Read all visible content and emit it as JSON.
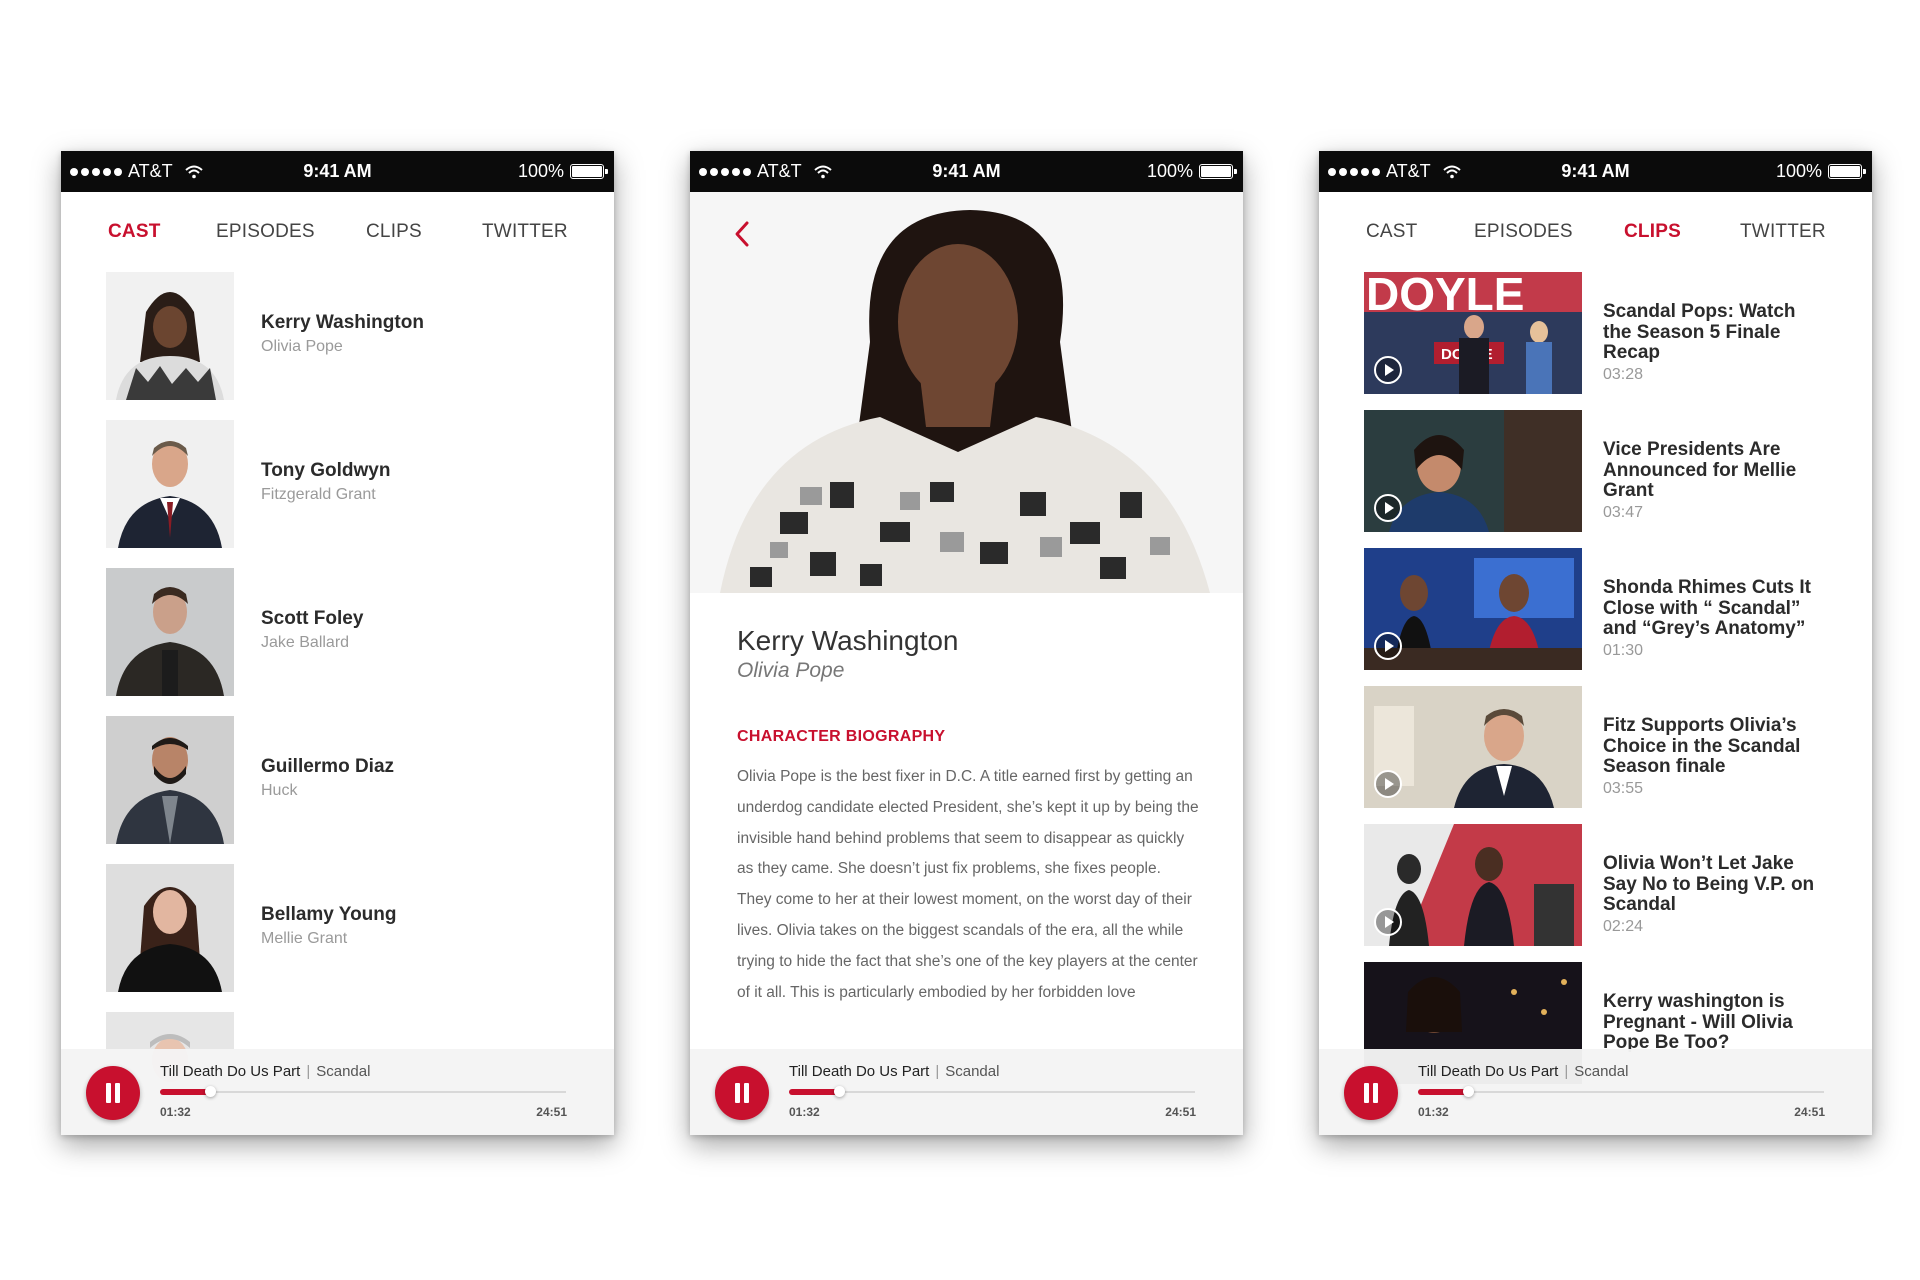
{
  "status": {
    "carrier": "AT&T",
    "time": "9:41 AM",
    "battery": "100%"
  },
  "tabs": [
    "CAST",
    "EPISODES",
    "CLIPS",
    "TWITTER"
  ],
  "cast": [
    {
      "name": "Kerry Washington",
      "role": "Olivia Pope"
    },
    {
      "name": "Tony Goldwyn",
      "role": "Fitzgerald Grant"
    },
    {
      "name": "Scott Foley",
      "role": "Jake Ballard"
    },
    {
      "name": "Guillermo Diaz",
      "role": "Huck"
    },
    {
      "name": "Bellamy Young",
      "role": "Mellie Grant"
    }
  ],
  "detail": {
    "name": "Kerry Washington",
    "role": "Olivia Pope",
    "heading": "CHARACTER BIOGRAPHY",
    "bio": "Olivia Pope is the best fixer in D.C. A title earned first by getting an underdog candidate elected President, she’s kept it up by being the invisible hand behind problems that seem to disappear as quickly as they came. She doesn’t just fix problems, she fixes people. They come to her at their lowest moment, on the worst day of their lives. Olivia takes on the biggest scandals of the era, all the while trying to hide the fact that she’s one of the key players at the center of it all. This is particularly embodied by her forbidden love"
  },
  "clips": [
    {
      "title": "Scandal Pops: Watch the Season 5 Finale Recap",
      "duration": "03:28",
      "thumb_text": "DOYLE"
    },
    {
      "title": "Vice Presidents Are Announced for Mellie Grant",
      "duration": "03:47"
    },
    {
      "title": "Shonda Rhimes Cuts It Close with “ Scandal” and “Grey’s Anatomy”",
      "duration": "01:30"
    },
    {
      "title": "Fitz Supports Olivia’s Choice in the Scandal Season finale",
      "duration": "03:55"
    },
    {
      "title": "Olivia Won’t Let Jake Say No to Being V.P. on Scandal",
      "duration": "02:24"
    },
    {
      "title": "Kerry washington is Pregnant - Will Olivia Pope Be Too?",
      "duration": ""
    }
  ],
  "player": {
    "episode": "Till Death Do Us Part",
    "separator": "|",
    "show": "Scandal",
    "elapsed": "01:32",
    "total": "24:51",
    "progress": 0.0617
  },
  "colors": {
    "accent": "#c8102e",
    "statusbar": "#0b0b0b"
  }
}
